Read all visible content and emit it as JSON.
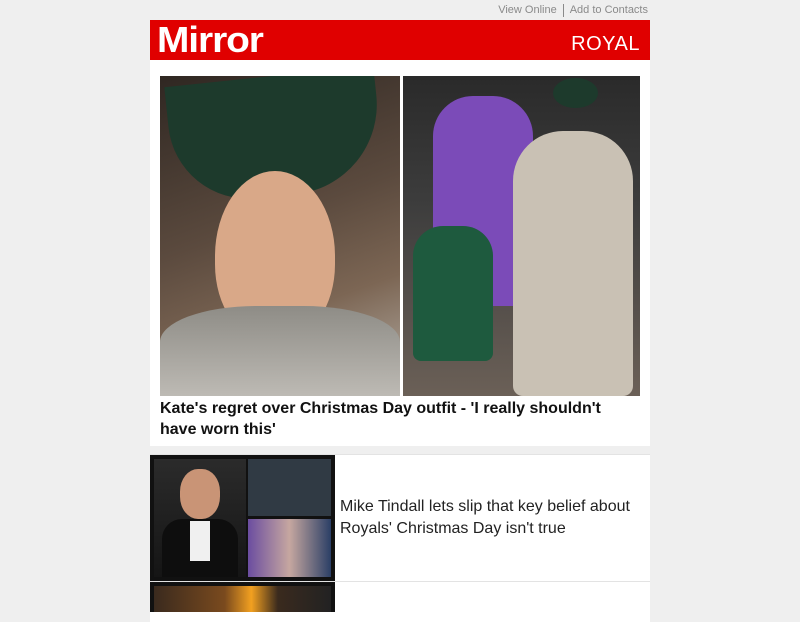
{
  "header": {
    "view_online": "View Online",
    "add_to_contacts": "Add to Contacts",
    "logo": "Mirror",
    "section": "ROYAL"
  },
  "lead": {
    "headline": "Kate's regret over Christmas Day outfit - 'I really shouldn't have worn this'"
  },
  "stories": [
    {
      "title": "Mike Tindall lets slip that key belief about Royals' Christmas Day isn't true"
    }
  ],
  "colors": {
    "brand_red": "#e00000",
    "page_bg": "#efefef",
    "card_bg": "#ffffff"
  }
}
